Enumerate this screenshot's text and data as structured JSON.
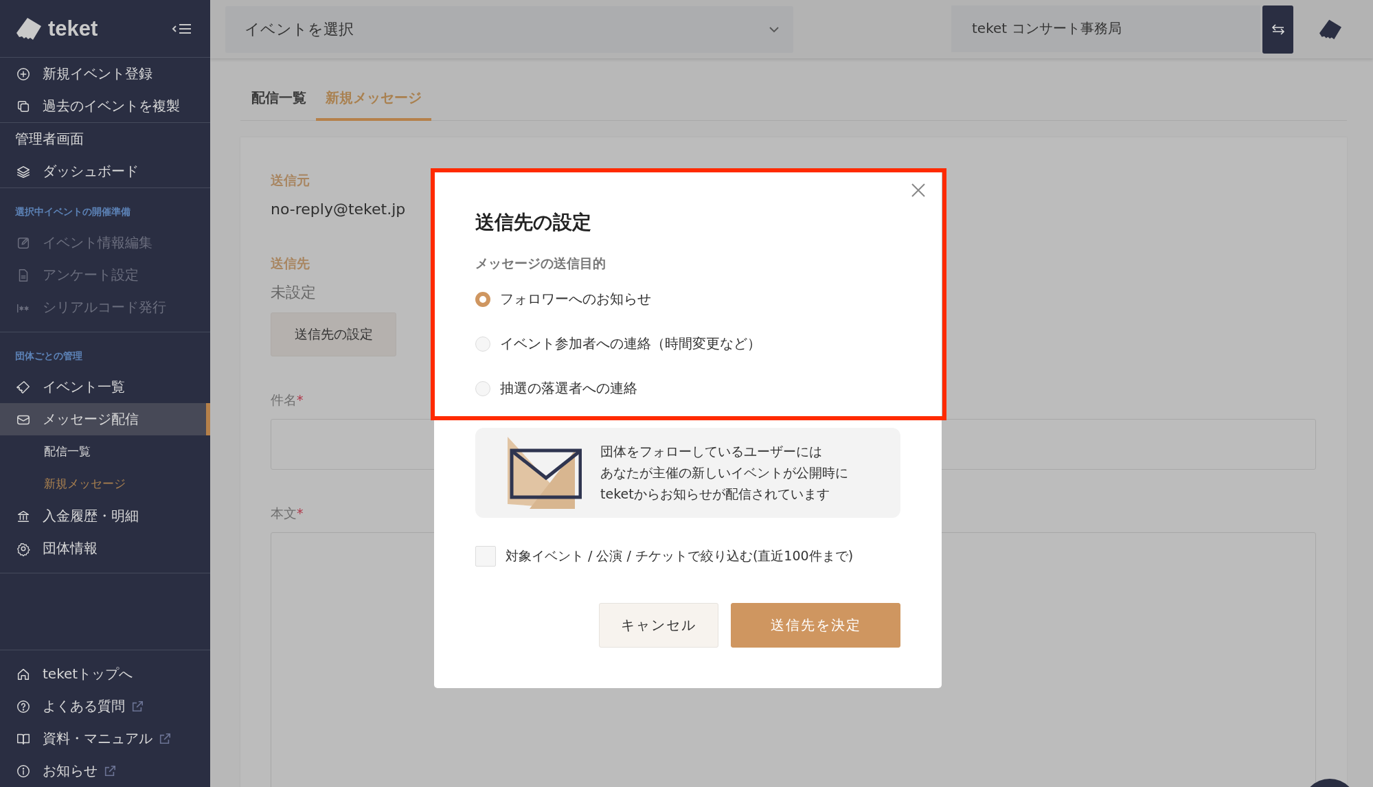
{
  "sidebar": {
    "logo": "teket",
    "groups": [
      {
        "items": [
          {
            "kind": "link",
            "label": "新規イベント登録"
          },
          {
            "kind": "link",
            "label": "過去のイベントを複製"
          }
        ]
      },
      {
        "items": [
          {
            "kind": "heading",
            "label": "管理者画面"
          },
          {
            "kind": "link",
            "label": "ダッシュボード"
          }
        ]
      },
      {
        "title": "選択中イベントの開催準備",
        "items": [
          {
            "kind": "link",
            "label": "イベント情報編集",
            "disabled": true
          },
          {
            "kind": "link",
            "label": "アンケート設定",
            "disabled": true
          },
          {
            "kind": "link",
            "label": "シリアルコード発行",
            "disabled": true
          }
        ]
      },
      {
        "title": "団体ごとの管理",
        "items": [
          {
            "kind": "link",
            "label": "イベント一覧",
            "selected": false
          },
          {
            "kind": "link",
            "label": "メッセージ配信",
            "selected": true,
            "expanded": true,
            "children": [
              {
                "label": "配信一覧",
                "selected": false
              },
              {
                "label": "新規メッセージ",
                "selected": true
              }
            ]
          },
          {
            "kind": "link",
            "label": "入金履歴・明細",
            "selected": false
          },
          {
            "kind": "link",
            "label": "団体情報",
            "selected": false
          }
        ]
      },
      {
        "items": [
          {
            "kind": "link",
            "label": "teketトップへ",
            "external": false
          },
          {
            "kind": "link",
            "label": "よくある質問",
            "external": true
          },
          {
            "kind": "link",
            "label": "資料・マニュアル",
            "external": true
          },
          {
            "kind": "link",
            "label": "お知らせ",
            "external": true
          }
        ]
      }
    ]
  },
  "top_bar": {
    "event_select": {
      "value": "イベントを選択"
    },
    "organization": {
      "value": "teket コンサート事務局"
    }
  },
  "tabs": [
    {
      "label": "配信一覧",
      "selected": false
    },
    {
      "label": "新規メッセージ",
      "selected": true
    }
  ],
  "form": {
    "sender": {
      "label": "送信元",
      "value": "no-reply@teket.jp"
    },
    "recipient": {
      "label": "送信先",
      "value": "未設定",
      "button": "送信先の設定"
    },
    "subject": {
      "label": "件名",
      "required_mark": "*"
    },
    "body": {
      "label": "本文",
      "required_mark": "*"
    }
  },
  "dialog": {
    "title": "送信先の設定",
    "subtitle": "メッセージの送信目的",
    "options": [
      {
        "label": "フォロワーへのお知らせ",
        "selected": true
      },
      {
        "label": "イベント参加者への連絡（時間変更など）",
        "selected": false
      },
      {
        "label": "抽選の落選者への連絡",
        "selected": false
      }
    ],
    "info": {
      "lines": [
        "団体をフォローしているユーザーには",
        "あなたが主催の新しいイベントが公開時に",
        "teketからお知らせが配信されています"
      ]
    },
    "filter": {
      "label": "対象イベント / 公演 / チケットで絞り込む(直近100件まで)",
      "checked": false
    },
    "buttons": [
      {
        "label": "キャンセル",
        "kind": "secondary"
      },
      {
        "label": "送信先を決定",
        "kind": "primary"
      }
    ]
  }
}
